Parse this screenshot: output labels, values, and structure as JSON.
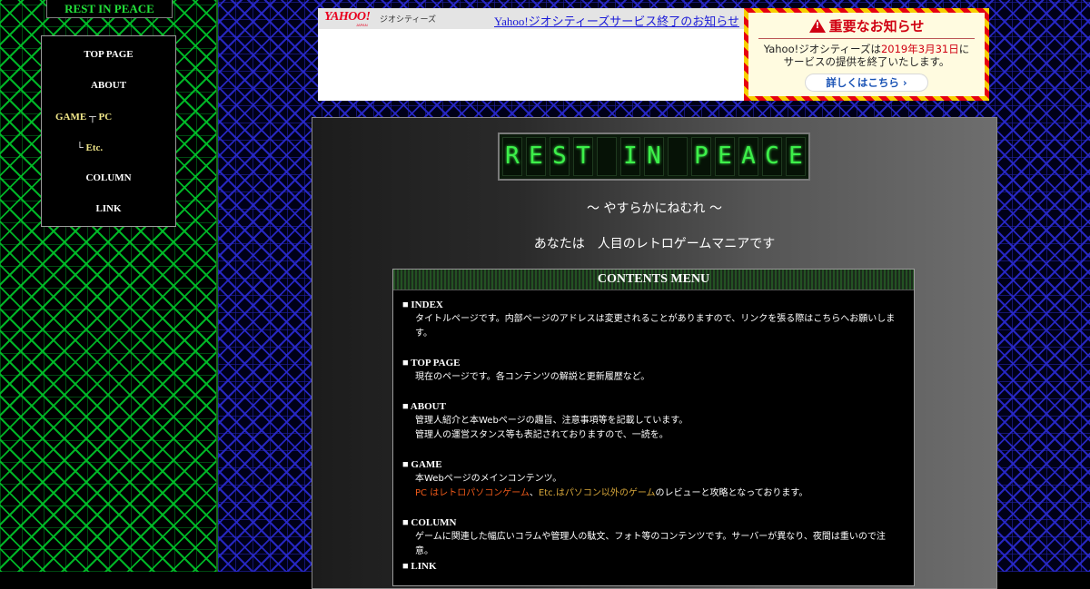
{
  "sidebar": {
    "title": "REST IN PEACE",
    "items": [
      {
        "label": "TOP PAGE"
      },
      {
        "label": "ABOUT"
      },
      {
        "label": "COLUMN"
      },
      {
        "label": "LINK"
      }
    ],
    "game": {
      "prefix": "GAME",
      "branch": "┬",
      "label": "PC"
    },
    "etc": {
      "branch": "└",
      "label": "Etc."
    }
  },
  "yahoo": {
    "logo": "YAHOO!",
    "japan": "JAPAN",
    "service": "ジオシティーズ",
    "link": "Yahoo!ジオシティーズサービス終了のお知らせ"
  },
  "notice": {
    "title": "重要なお知らせ",
    "line1a": "Yahoo!ジオシティーズは",
    "date": "2019年3月31日",
    "line1b": "に",
    "line2": "サービスの提供を終了いたします。",
    "button": "詳しくはこちら ›"
  },
  "main": {
    "lcd_text": [
      "R",
      "E",
      "S",
      "T",
      "",
      "I",
      "N",
      "",
      "P",
      "E",
      "A",
      "C",
      "E"
    ],
    "subtitle": "～ やすらかにねむれ ～",
    "visitor": "あなたは　人目のレトロゲームマニアです"
  },
  "menu": {
    "title": "CONTENTS MENU",
    "sections": [
      {
        "head": "■ INDEX",
        "lines": [
          "タイトルページです。内部ページのアドレスは変更されることがありますので、リンクを張る際はこちらへお願いしま",
          "す。"
        ]
      },
      {
        "head": "■ TOP PAGE",
        "lines": [
          "現在のページです。各コンテンツの解説と更新履歴など。"
        ]
      },
      {
        "head": "■ ABOUT",
        "lines": [
          "管理人紹介と本Webページの趣旨、注意事項等を記載しています。",
          "管理人の運営スタンス等も表記されておりますので、一読を。"
        ]
      },
      {
        "head": "■ GAME",
        "lines": [
          "本Webページのメインコンテンツ。"
        ]
      },
      {
        "head": "■ COLUMN",
        "lines": [
          "ゲームに関連した幅広いコラムや管理人の駄文、フォト等のコンテンツです。サーバーが異なり、夜間は重いので注意。"
        ]
      },
      {
        "head": "■ LINK",
        "lines": []
      }
    ],
    "game_line2": {
      "pc": "PC はレトロパソコンゲーム",
      "sep": "、",
      "etc": "Etc.はパソコン以外のゲーム",
      "rest": "のレビューと攻略となっております。"
    }
  }
}
